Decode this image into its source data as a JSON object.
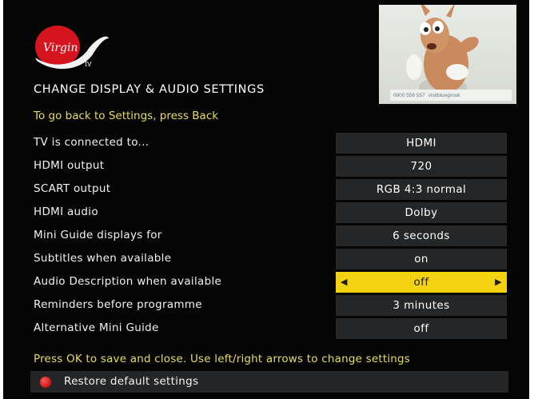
{
  "logo": {
    "brand": "Virgin",
    "suffix": "tv",
    "icon": "virgin-tv-logo"
  },
  "preview": {
    "phone": "0800 556 557",
    "site": "visitbluegrouk"
  },
  "header": {
    "title": "CHANGE DISPLAY & AUDIO SETTINGS",
    "back_hint": "To go back to Settings, press Back"
  },
  "settings": [
    {
      "label": "TV is connected to...",
      "value": "HDMI"
    },
    {
      "label": "HDMI output",
      "value": "720"
    },
    {
      "label": "SCART output",
      "value": "RGB 4:3 normal"
    },
    {
      "label": "HDMI audio",
      "value": "Dolby"
    },
    {
      "label": "Mini Guide displays for",
      "value": "6 seconds"
    },
    {
      "label": "Subtitles when available",
      "value": "on"
    },
    {
      "label": "Audio Description when available",
      "value": "off",
      "selected": true
    },
    {
      "label": "Reminders before programme",
      "value": "3 minutes"
    },
    {
      "label": "Alternative Mini Guide",
      "value": "off"
    }
  ],
  "footer": {
    "hint": "Press OK to save and close. Use left/right arrows to change settings",
    "restore_label": "Restore default settings",
    "restore_icon": "red-button-icon"
  },
  "colors": {
    "background": "#050505",
    "accent_yellow": "#e8dd5a",
    "selected_bg": "#f3d210",
    "value_bg": "#252627",
    "red_button": "#d01818"
  }
}
